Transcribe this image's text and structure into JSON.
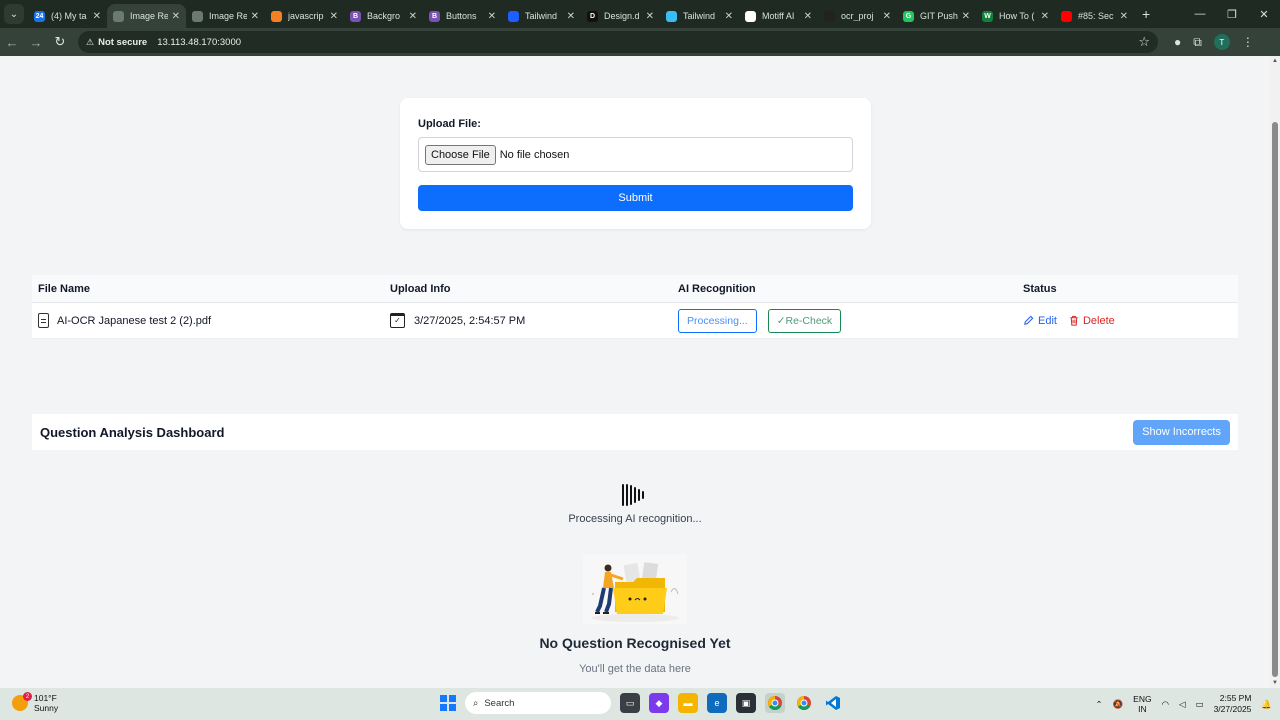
{
  "browser": {
    "tabs": [
      {
        "label": "(4) My ta",
        "fav": "24",
        "favColor": "#1a73e8"
      },
      {
        "label": "Image Re",
        "fav": "",
        "favColor": "#6b7a70",
        "active": true
      },
      {
        "label": "Image Re",
        "fav": "",
        "favColor": "#6b7a70"
      },
      {
        "label": "javascrip",
        "fav": "",
        "favColor": "#f48024"
      },
      {
        "label": "Backgro",
        "fav": "B",
        "favColor": "#7952b3"
      },
      {
        "label": "Buttons",
        "fav": "B",
        "favColor": "#7952b3"
      },
      {
        "label": "Tailwind",
        "fav": "",
        "favColor": "#1e5eff"
      },
      {
        "label": "Design.d",
        "fav": "D",
        "favColor": "#111111"
      },
      {
        "label": "Tailwind",
        "fav": "",
        "favColor": "#38bdf8"
      },
      {
        "label": "Motiff AI",
        "fav": "",
        "favColor": "#ffffff"
      },
      {
        "label": "ocr_proj",
        "fav": "",
        "favColor": "#222222"
      },
      {
        "label": "GIT Push",
        "fav": "G",
        "favColor": "#22c55e"
      },
      {
        "label": "How To (",
        "fav": "W",
        "favColor": "#15803d"
      },
      {
        "label": "#85: Sec",
        "fav": "",
        "favColor": "#ff0000"
      }
    ],
    "address": {
      "security": "Not secure",
      "url": "13.113.48.170:3000"
    },
    "profile_initial": "T"
  },
  "upload": {
    "label": "Upload File:",
    "choose_label": "Choose File",
    "no_file": "No file chosen",
    "submit_label": "Submit"
  },
  "table": {
    "headers": [
      "File Name",
      "Upload Info",
      "AI Recognition",
      "Status"
    ],
    "rows": [
      {
        "file_name": "AI-OCR Japanese test 2 (2).pdf",
        "upload_info": "3/27/2025, 2:54:57 PM",
        "processing_label": "Processing...",
        "recheck_label": "✓Re-Check",
        "edit_label": "Edit",
        "delete_label": "Delete"
      }
    ]
  },
  "dashboard": {
    "title": "Question Analysis Dashboard",
    "show_incorrects_label": "Show Incorrects",
    "processing_text": "Processing AI recognition...",
    "empty_title": "No Question Recognised Yet",
    "empty_subtitle": "You'll get the data here"
  },
  "taskbar": {
    "weather_temp": "101°F",
    "weather_desc": "Sunny",
    "weather_badge": "2",
    "search_placeholder": "Search",
    "lang_top": "ENG",
    "lang_bottom": "IN",
    "time": "2:55 PM",
    "date": "3/27/2025"
  },
  "colors": {
    "primary": "#0d6efd",
    "success": "#198754",
    "danger": "#dc2626",
    "show_incorrects_bg": "#60a5fa"
  }
}
